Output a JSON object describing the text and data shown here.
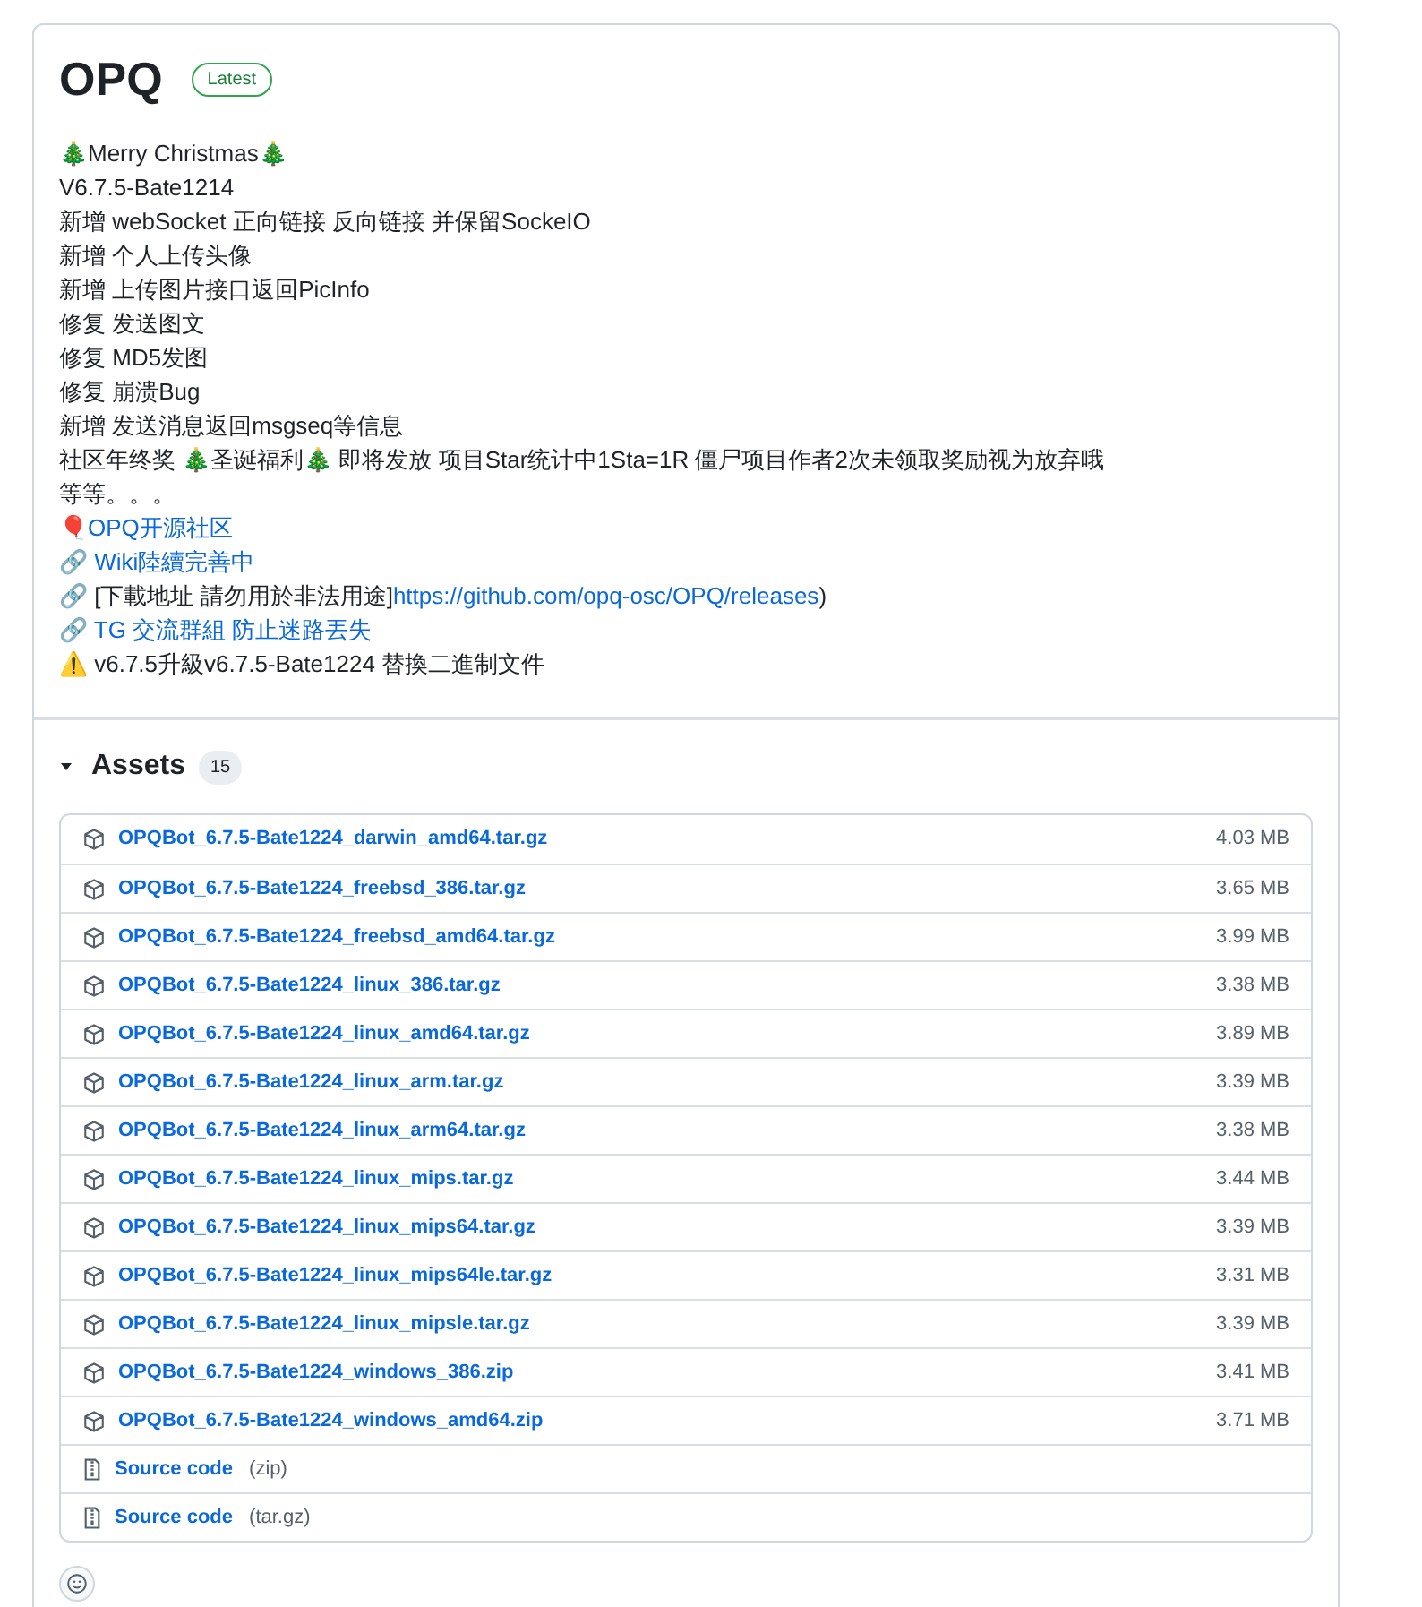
{
  "release": {
    "title": "OPQ",
    "badge": "Latest"
  },
  "notes": [
    {
      "parts": [
        {
          "kind": "text",
          "text": "🎄Merry Christmas🎄"
        }
      ]
    },
    {
      "parts": [
        {
          "kind": "text",
          "text": "V6.7.5-Bate1214"
        }
      ]
    },
    {
      "parts": [
        {
          "kind": "text",
          "text": "新增 webSocket 正向链接 反向链接 并保留SockeIO"
        }
      ]
    },
    {
      "parts": [
        {
          "kind": "text",
          "text": "新增 个人上传头像"
        }
      ]
    },
    {
      "parts": [
        {
          "kind": "text",
          "text": "新增 上传图片接口返回PicInfo"
        }
      ]
    },
    {
      "parts": [
        {
          "kind": "text",
          "text": "修复 发送图文"
        }
      ]
    },
    {
      "parts": [
        {
          "kind": "text",
          "text": "修复 MD5发图"
        }
      ]
    },
    {
      "parts": [
        {
          "kind": "text",
          "text": "修复 崩溃Bug"
        }
      ]
    },
    {
      "parts": [
        {
          "kind": "text",
          "text": "新增 发送消息返回msgseq等信息"
        }
      ]
    },
    {
      "parts": [
        {
          "kind": "text",
          "text": "社区年终奖 🎄圣诞福利🎄 即将发放 项目Star统计中1Sta=1R 僵尸项目作者2次未领取奖励视为放弃哦"
        }
      ]
    },
    {
      "parts": [
        {
          "kind": "text",
          "text": "等等。。。"
        }
      ]
    },
    {
      "parts": [
        {
          "kind": "text",
          "text": "🎈"
        },
        {
          "kind": "link",
          "text": "OPQ开源社区"
        }
      ]
    },
    {
      "parts": [
        {
          "kind": "text",
          "text": "🔗 "
        },
        {
          "kind": "link",
          "text": "Wiki陸續完善中"
        }
      ]
    },
    {
      "parts": [
        {
          "kind": "text",
          "text": "🔗 [下載地址 請勿用於非法用途]"
        },
        {
          "kind": "link",
          "text": "https://github.com/opq-osc/OPQ/releases"
        },
        {
          "kind": "text",
          "text": ")"
        }
      ]
    },
    {
      "parts": [
        {
          "kind": "text",
          "text": "🔗 "
        },
        {
          "kind": "link",
          "text": "TG 交流群組 防止迷路丟失"
        }
      ]
    },
    {
      "parts": [
        {
          "kind": "text",
          "text": "⚠️ v6.7.5升級v6.7.5-Bate1224 替換二進制文件"
        }
      ]
    }
  ],
  "assets": {
    "title": "Assets",
    "count": "15",
    "expanded": true,
    "items": [
      {
        "kind": "package",
        "name": "OPQBot_6.7.5-Bate1224_darwin_amd64.tar.gz",
        "size": "4.03 MB"
      },
      {
        "kind": "package",
        "name": "OPQBot_6.7.5-Bate1224_freebsd_386.tar.gz",
        "size": "3.65 MB"
      },
      {
        "kind": "package",
        "name": "OPQBot_6.7.5-Bate1224_freebsd_amd64.tar.gz",
        "size": "3.99 MB"
      },
      {
        "kind": "package",
        "name": "OPQBot_6.7.5-Bate1224_linux_386.tar.gz",
        "size": "3.38 MB"
      },
      {
        "kind": "package",
        "name": "OPQBot_6.7.5-Bate1224_linux_amd64.tar.gz",
        "size": "3.89 MB"
      },
      {
        "kind": "package",
        "name": "OPQBot_6.7.5-Bate1224_linux_arm.tar.gz",
        "size": "3.39 MB"
      },
      {
        "kind": "package",
        "name": "OPQBot_6.7.5-Bate1224_linux_arm64.tar.gz",
        "size": "3.38 MB"
      },
      {
        "kind": "package",
        "name": "OPQBot_6.7.5-Bate1224_linux_mips.tar.gz",
        "size": "3.44 MB"
      },
      {
        "kind": "package",
        "name": "OPQBot_6.7.5-Bate1224_linux_mips64.tar.gz",
        "size": "3.39 MB"
      },
      {
        "kind": "package",
        "name": "OPQBot_6.7.5-Bate1224_linux_mips64le.tar.gz",
        "size": "3.31 MB"
      },
      {
        "kind": "package",
        "name": "OPQBot_6.7.5-Bate1224_linux_mipsle.tar.gz",
        "size": "3.39 MB"
      },
      {
        "kind": "package",
        "name": "OPQBot_6.7.5-Bate1224_windows_386.zip",
        "size": "3.41 MB"
      },
      {
        "kind": "package",
        "name": "OPQBot_6.7.5-Bate1224_windows_amd64.zip",
        "size": "3.71 MB"
      },
      {
        "kind": "source",
        "name": "Source code",
        "format": "(zip)"
      },
      {
        "kind": "source",
        "name": "Source code",
        "format": "(tar.gz)"
      }
    ]
  }
}
